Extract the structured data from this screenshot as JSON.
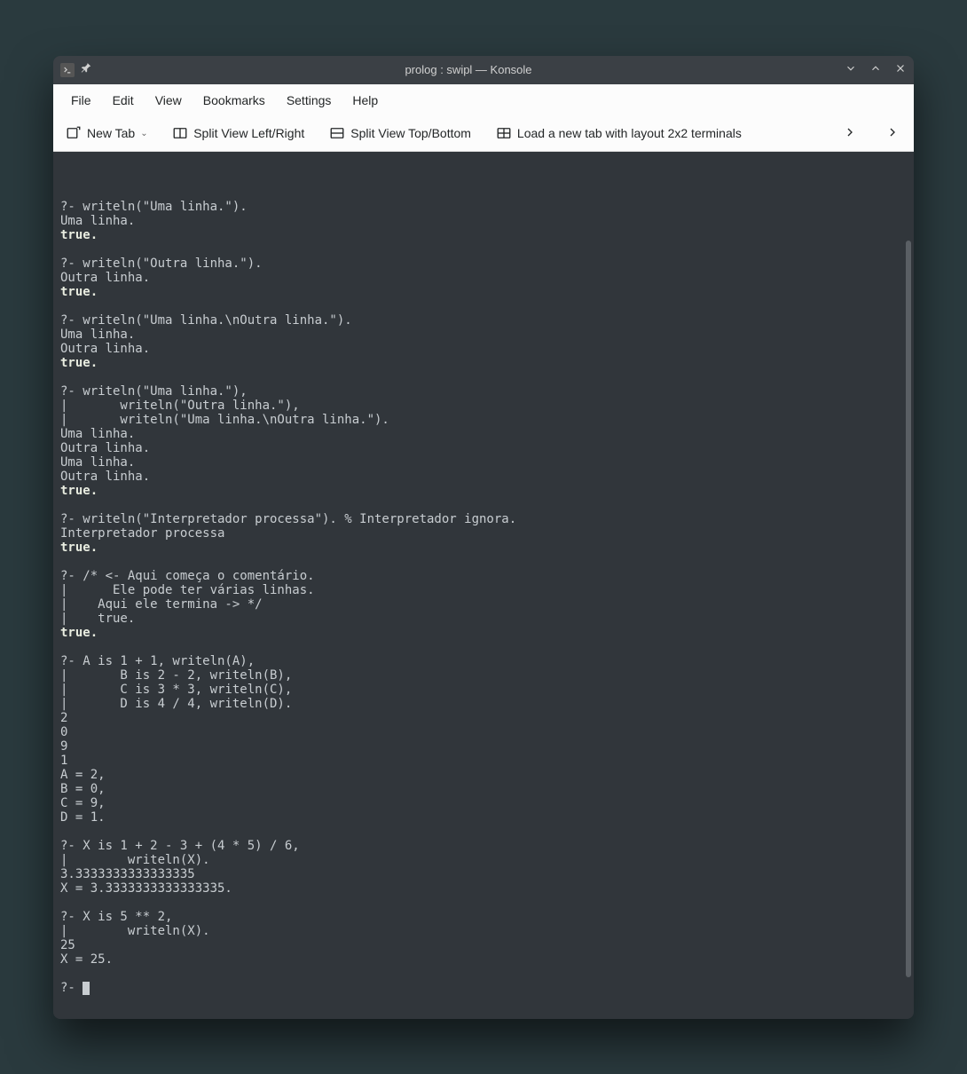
{
  "titlebar": {
    "title": "prolog : swipl — Konsole"
  },
  "menubar": {
    "file": "File",
    "edit": "Edit",
    "view": "View",
    "bookmarks": "Bookmarks",
    "settings": "Settings",
    "help": "Help"
  },
  "toolbar": {
    "new_tab": "New Tab",
    "split_lr": "Split View Left/Right",
    "split_tb": "Split View Top/Bottom",
    "load_layout": "Load a new tab with layout 2x2 terminals"
  },
  "terminal": {
    "lines": [
      {
        "t": "",
        "b": false
      },
      {
        "t": "?- writeln(\"Uma linha.\").",
        "b": false
      },
      {
        "t": "Uma linha.",
        "b": false
      },
      {
        "t": "true.",
        "b": true
      },
      {
        "t": "",
        "b": false
      },
      {
        "t": "?- writeln(\"Outra linha.\").",
        "b": false
      },
      {
        "t": "Outra linha.",
        "b": false
      },
      {
        "t": "true.",
        "b": true
      },
      {
        "t": "",
        "b": false
      },
      {
        "t": "?- writeln(\"Uma linha.\\nOutra linha.\").",
        "b": false
      },
      {
        "t": "Uma linha.",
        "b": false
      },
      {
        "t": "Outra linha.",
        "b": false
      },
      {
        "t": "true.",
        "b": true
      },
      {
        "t": "",
        "b": false
      },
      {
        "t": "?- writeln(\"Uma linha.\"),",
        "b": false
      },
      {
        "t": "|       writeln(\"Outra linha.\"),",
        "b": false
      },
      {
        "t": "|       writeln(\"Uma linha.\\nOutra linha.\").",
        "b": false
      },
      {
        "t": "Uma linha.",
        "b": false
      },
      {
        "t": "Outra linha.",
        "b": false
      },
      {
        "t": "Uma linha.",
        "b": false
      },
      {
        "t": "Outra linha.",
        "b": false
      },
      {
        "t": "true.",
        "b": true
      },
      {
        "t": "",
        "b": false
      },
      {
        "t": "?- writeln(\"Interpretador processa\"). % Interpretador ignora.",
        "b": false
      },
      {
        "t": "Interpretador processa",
        "b": false
      },
      {
        "t": "true.",
        "b": true
      },
      {
        "t": "",
        "b": false
      },
      {
        "t": "?- /* <- Aqui começa o comentário.",
        "b": false
      },
      {
        "t": "|      Ele pode ter várias linhas.",
        "b": false
      },
      {
        "t": "|    Aqui ele termina -> */",
        "b": false
      },
      {
        "t": "|    true.",
        "b": false
      },
      {
        "t": "true.",
        "b": true
      },
      {
        "t": "",
        "b": false
      },
      {
        "t": "?- A is 1 + 1, writeln(A),",
        "b": false
      },
      {
        "t": "|       B is 2 - 2, writeln(B),",
        "b": false
      },
      {
        "t": "|       C is 3 * 3, writeln(C),",
        "b": false
      },
      {
        "t": "|       D is 4 / 4, writeln(D).",
        "b": false
      },
      {
        "t": "2",
        "b": false
      },
      {
        "t": "0",
        "b": false
      },
      {
        "t": "9",
        "b": false
      },
      {
        "t": "1",
        "b": false
      },
      {
        "t": "A = 2,",
        "b": false
      },
      {
        "t": "B = 0,",
        "b": false
      },
      {
        "t": "C = 9,",
        "b": false
      },
      {
        "t": "D = 1.",
        "b": false
      },
      {
        "t": "",
        "b": false
      },
      {
        "t": "?- X is 1 + 2 - 3 + (4 * 5) / 6,",
        "b": false
      },
      {
        "t": "|        writeln(X).",
        "b": false
      },
      {
        "t": "3.3333333333333335",
        "b": false
      },
      {
        "t": "X = 3.3333333333333335.",
        "b": false
      },
      {
        "t": "",
        "b": false
      },
      {
        "t": "?- X is 5 ** 2,",
        "b": false
      },
      {
        "t": "|        writeln(X).",
        "b": false
      },
      {
        "t": "25",
        "b": false
      },
      {
        "t": "X = 25.",
        "b": false
      },
      {
        "t": "",
        "b": false
      }
    ],
    "prompt": "?- "
  }
}
